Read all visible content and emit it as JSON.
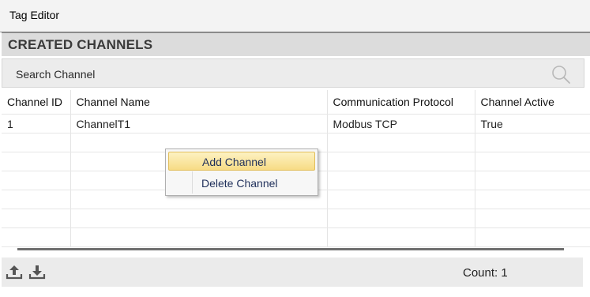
{
  "window": {
    "title": "Tag Editor"
  },
  "channels": {
    "header": "CREATED CHANNELS",
    "search": {
      "placeholder": "Search Channel"
    },
    "columns": [
      "Channel ID",
      "Channel Name",
      "Communication Protocol",
      "Channel Active"
    ],
    "rows": [
      [
        "1",
        "ChannelT1",
        "Modbus TCP",
        "True"
      ]
    ]
  },
  "context_menu": {
    "items": [
      {
        "label": "Add Channel",
        "highlighted": true
      },
      {
        "label": "Delete Channel",
        "highlighted": false
      }
    ]
  },
  "statusbar": {
    "count_text": "Count: 1",
    "icons": [
      "upload-icon",
      "download-icon"
    ]
  },
  "colors": {
    "menu_highlight": "#f7dc85",
    "header_bg": "#dcdcdc"
  }
}
